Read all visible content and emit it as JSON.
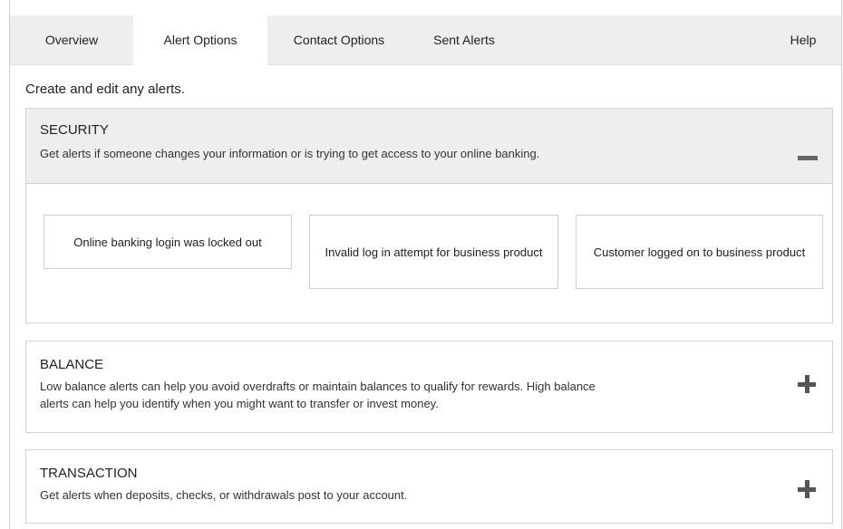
{
  "tabs": [
    {
      "label": "Overview"
    },
    {
      "label": "Alert Options"
    },
    {
      "label": "Contact Options"
    },
    {
      "label": "Sent Alerts"
    }
  ],
  "help_label": "Help",
  "active_tab": "Alert Options",
  "intro": "Create and edit any alerts.",
  "sections": [
    {
      "title": "SECURITY",
      "description": "Get alerts if someone changes your information or is trying to get access to your online banking.",
      "toggle": "minus-icon",
      "expanded": true,
      "alerts": [
        {
          "label": "Online banking login was locked out"
        },
        {
          "label": "Invalid log in attempt for business product"
        },
        {
          "label": "Customer logged on to business product"
        }
      ]
    },
    {
      "title": "BALANCE",
      "description_line1": "Low balance alerts can help you avoid overdrafts or maintain balances to qualify for rewards. High balance",
      "description_line2": "alerts can help you identify when you might want to transfer or invest money.",
      "toggle": "plus-icon",
      "expanded": false
    },
    {
      "title": "TRANSACTION",
      "description": "Get alerts when deposits, checks, or withdrawals post to your account.",
      "toggle": "plus-icon",
      "expanded": false
    }
  ],
  "colors": {
    "tab_bar_bg": "#eeeeee",
    "section_header_bg": "#eeeeee",
    "border": "#d3d3d3",
    "icon": "#555555"
  }
}
